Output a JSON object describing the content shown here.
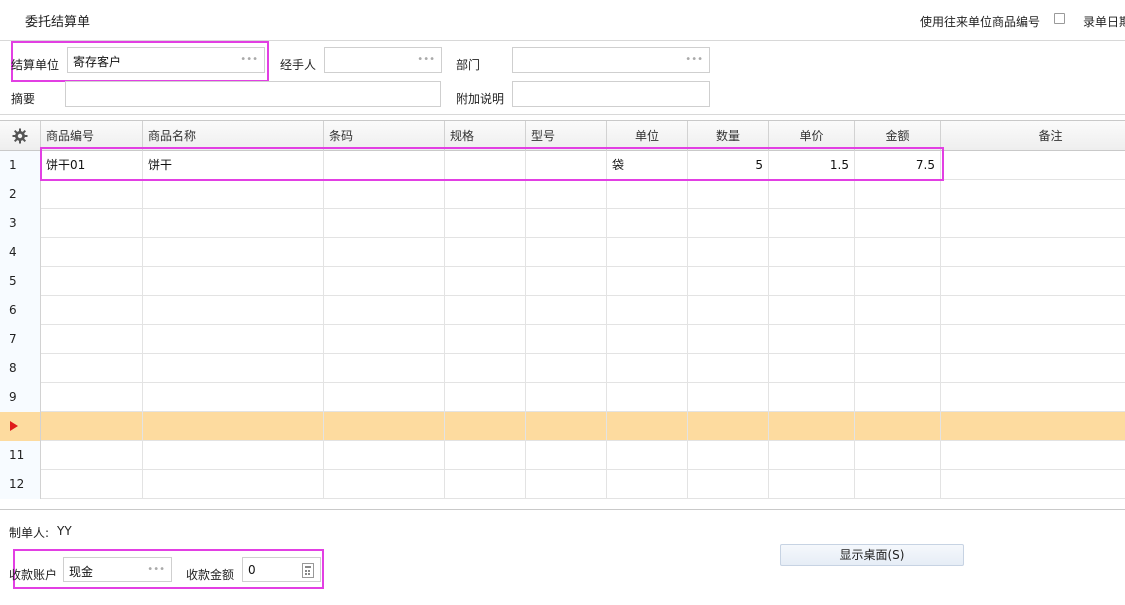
{
  "header": {
    "title": "委托结算单",
    "option_use_partner_code": "使用往来单位商品编号",
    "option_entry_date": "录单日期"
  },
  "form": {
    "settle_unit_label": "结算单位",
    "settle_unit_value": "寄存客户",
    "handler_label": "经手人",
    "handler_value": "",
    "dept_label": "部门",
    "dept_value": "",
    "summary_label": "摘要",
    "summary_value": "",
    "extra_label": "附加说明",
    "extra_value": ""
  },
  "grid": {
    "columns": [
      "商品编号",
      "商品名称",
      "条码",
      "规格",
      "型号",
      "单位",
      "数量",
      "单价",
      "金额",
      "备注"
    ],
    "rows": [
      {
        "no": "1",
        "code": "饼干01",
        "name": "饼干",
        "barcode": "",
        "spec": "",
        "model": "",
        "unit": "袋",
        "qty": "5",
        "price": "1.5",
        "amount": "7.5",
        "note": ""
      },
      {
        "no": "2"
      },
      {
        "no": "3"
      },
      {
        "no": "4"
      },
      {
        "no": "5"
      },
      {
        "no": "6"
      },
      {
        "no": "7"
      },
      {
        "no": "8"
      },
      {
        "no": "9"
      },
      {
        "no": ""
      },
      {
        "no": "11"
      },
      {
        "no": "12"
      }
    ]
  },
  "footer": {
    "maker_label": "制单人:",
    "maker_value": "YY",
    "account_label": "收款账户",
    "account_value": "现金",
    "amount_label": "收款金额",
    "amount_value": "0",
    "show_desktop_button": "显示桌面(S)"
  },
  "icons": {
    "settings": "gear-icon",
    "lookup": "ellipsis-icon",
    "current_row": "row-pointer-icon",
    "calculator": "calculator-icon"
  },
  "colors": {
    "highlight_border": "#e23fe3",
    "active_row": "#fddb9f",
    "row_pointer": "#e01b1b"
  }
}
